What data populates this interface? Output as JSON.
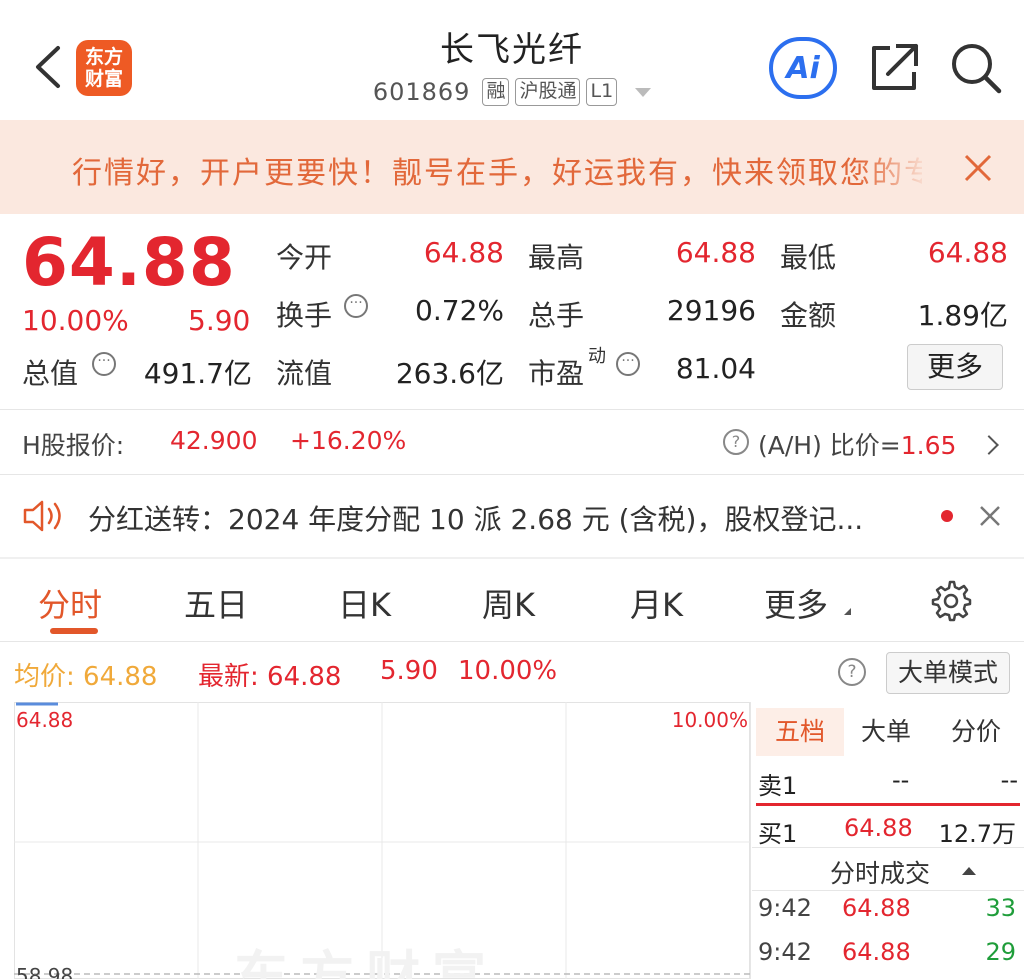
{
  "header": {
    "title": "长飞光纤",
    "logo_lines": [
      "东方",
      "财富"
    ],
    "code": "601869",
    "tags": [
      "融",
      "沪股通",
      "L1"
    ],
    "ai_label": "Ai"
  },
  "promo": {
    "text": "行情好，开户更要快！靓号在手，好运我有，快来领取您的专属靓号"
  },
  "quote": {
    "price": "64.88",
    "change_pct": "10.00%",
    "change": "5.90",
    "rows": [
      {
        "l1": "今开",
        "v1": "64.88",
        "l2": "最高",
        "v2": "64.88",
        "l3": "最低",
        "v3": "64.88"
      },
      {
        "l1": "换手",
        "v1": "0.72%",
        "l2": "总手",
        "v2": "29196",
        "l3": "金额",
        "v3": "1.89亿"
      }
    ],
    "total_cap_label": "总值",
    "total_cap": "491.7亿",
    "float_cap_label": "流值",
    "float_cap": "263.6亿",
    "pe_label": "市盈",
    "pe_sup": "动",
    "pe": "81.04",
    "more": "更多"
  },
  "hshare": {
    "label": "H股报价:",
    "price": "42.900",
    "change_pct": "+16.20%",
    "ah_label": "(A/H) 比价=",
    "ah_value": "1.65",
    "help": "?"
  },
  "notice": {
    "text": "分红送转：2024 年度分配 10 派 2.68 元 (含税)，股权登记..."
  },
  "tabs": [
    "分时",
    "五日",
    "日K",
    "周K",
    "月K",
    "更多"
  ],
  "stats": {
    "avg_label": "均价:",
    "avg": "64.88",
    "latest_label": "最新:",
    "latest": "64.88",
    "change": "5.90",
    "change_pct": "10.00%",
    "big_order": "大单模式",
    "help": "?"
  },
  "chart": {
    "top_label": "64.88",
    "top_pct": "10.00%",
    "bottom_label": "58.98",
    "watermark": "东方财富"
  },
  "order_panel": {
    "tabs": [
      "五档",
      "大单",
      "分价"
    ],
    "sell1": {
      "label": "卖1",
      "price": "--",
      "vol": "--"
    },
    "buy1": {
      "label": "买1",
      "price": "64.88",
      "vol": "12.7万"
    },
    "ticks_title": "分时成交",
    "ticks": [
      {
        "time": "9:42",
        "price": "64.88",
        "vol": "33"
      },
      {
        "time": "9:42",
        "price": "64.88",
        "vol": "29"
      }
    ]
  },
  "colors": {
    "up_red": "#e3262f",
    "accent_orange": "#e2572a",
    "avg_yellow": "#f0a93a",
    "ai_blue": "#2c6fef",
    "promo_bg": "#fbe8df",
    "volume_green": "#1f9d3a"
  }
}
